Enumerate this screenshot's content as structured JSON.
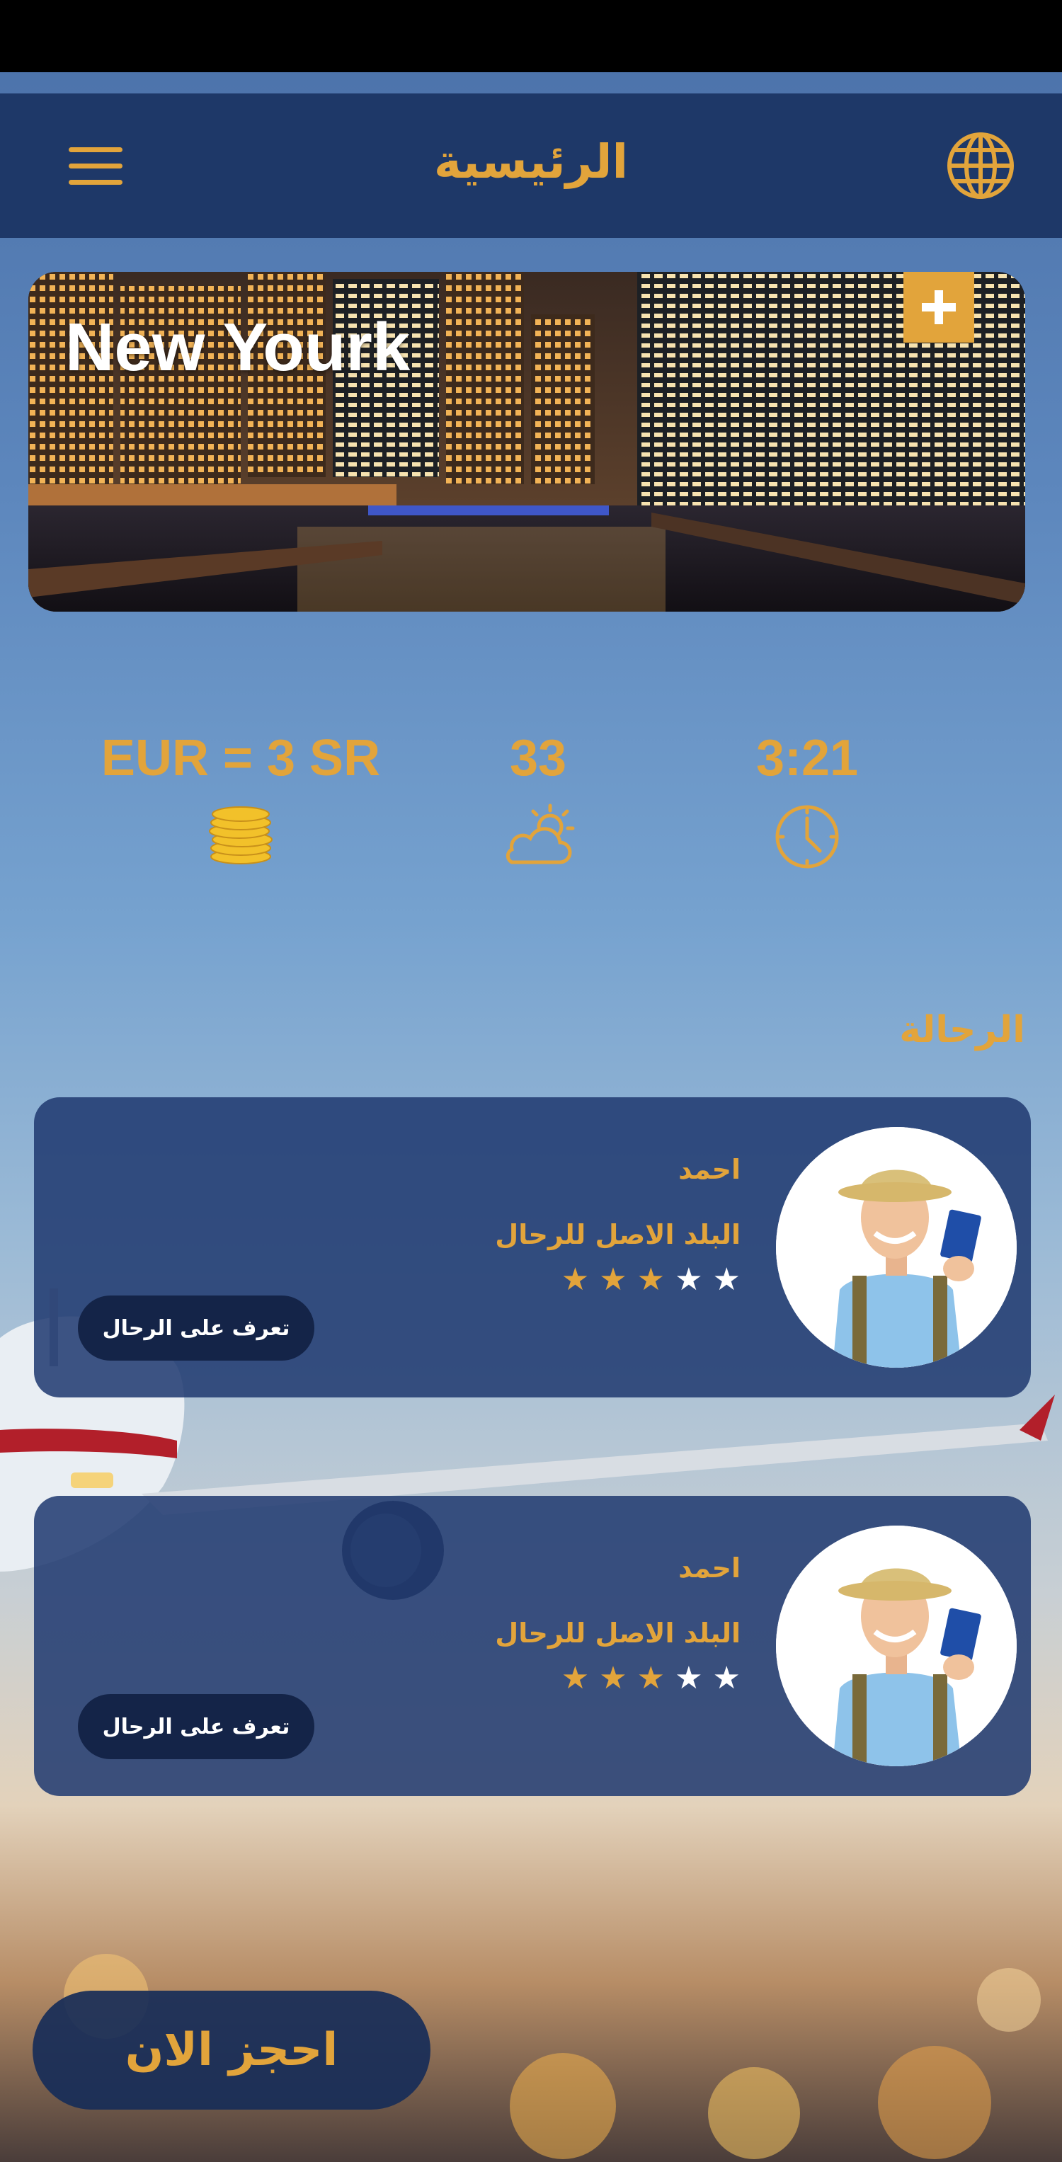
{
  "header": {
    "title": "الرئيسية",
    "menu_icon": "hamburger-menu-icon",
    "language_icon": "globe-icon"
  },
  "city": {
    "name": "New Yourk",
    "add_icon": "plus-icon"
  },
  "info": {
    "currency": "EUR = 3 SR",
    "currency_icon": "coins-icon",
    "temperature": "33",
    "weather_icon": "partly-cloudy-sun-icon",
    "time": "3:21",
    "time_icon": "clock-icon"
  },
  "section": {
    "title": "الرحالة"
  },
  "travelers": [
    {
      "name": "احمد",
      "country": "البلد الاصل للرحال",
      "rating": 3,
      "max_rating": 5,
      "button_label": "تعرف على الرحال"
    },
    {
      "name": "احمد",
      "country": "البلد الاصل للرحال",
      "rating": 3,
      "max_rating": 5,
      "button_label": "تعرف على الرحال"
    }
  ],
  "book_button": "احجز الان",
  "colors": {
    "accent": "#e2a43b",
    "header_bg": "#1e3868",
    "card_bg": "#1f3970",
    "button_dark": "#142448"
  }
}
